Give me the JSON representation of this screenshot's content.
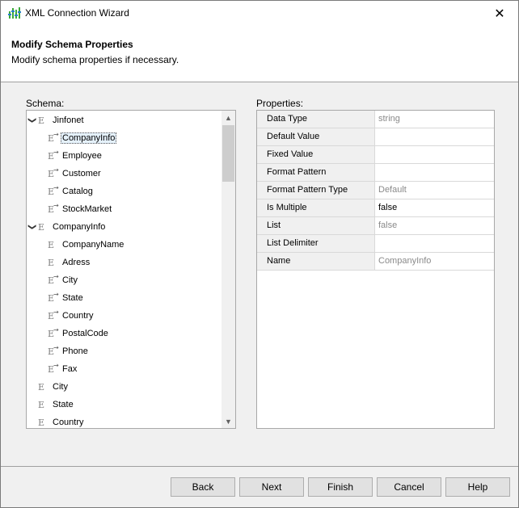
{
  "window": {
    "title": "XML Connection Wizard"
  },
  "header": {
    "title": "Modify Schema Properties",
    "subtitle": "Modify schema properties if necessary."
  },
  "schema": {
    "label": "Schema:",
    "nodes": [
      {
        "label": "Jinfonet",
        "expanded": true,
        "level": 0,
        "icon": "element-icon",
        "ref": false
      },
      {
        "label": "CompanyInfo",
        "level": 1,
        "icon": "element-ref-icon",
        "ref": true,
        "selected": true
      },
      {
        "label": "Employee",
        "level": 1,
        "icon": "element-ref-icon",
        "ref": true
      },
      {
        "label": "Customer",
        "level": 1,
        "icon": "element-ref-icon",
        "ref": true
      },
      {
        "label": "Catalog",
        "level": 1,
        "icon": "element-ref-icon",
        "ref": true
      },
      {
        "label": "StockMarket",
        "level": 1,
        "icon": "element-ref-icon",
        "ref": true
      },
      {
        "label": "CompanyInfo",
        "expanded": true,
        "level": 0,
        "icon": "element-icon",
        "ref": false
      },
      {
        "label": "CompanyName",
        "level": 1,
        "icon": "element-icon",
        "ref": false
      },
      {
        "label": "Adress",
        "level": 1,
        "icon": "element-icon",
        "ref": false
      },
      {
        "label": "City",
        "level": 1,
        "icon": "element-ref-icon",
        "ref": true
      },
      {
        "label": "State",
        "level": 1,
        "icon": "element-ref-icon",
        "ref": true
      },
      {
        "label": "Country",
        "level": 1,
        "icon": "element-ref-icon",
        "ref": true
      },
      {
        "label": "PostalCode",
        "level": 1,
        "icon": "element-ref-icon",
        "ref": true
      },
      {
        "label": "Phone",
        "level": 1,
        "icon": "element-ref-icon",
        "ref": true
      },
      {
        "label": "Fax",
        "level": 1,
        "icon": "element-ref-icon",
        "ref": true
      },
      {
        "label": "City",
        "level": 0,
        "icon": "element-icon",
        "ref": false
      },
      {
        "label": "State",
        "level": 0,
        "icon": "element-icon",
        "ref": false
      },
      {
        "label": "Country",
        "level": 0,
        "icon": "element-icon",
        "ref": false
      }
    ]
  },
  "properties": {
    "label": "Properties:",
    "rows": [
      {
        "name": "Data Type",
        "value": "string",
        "editable": false
      },
      {
        "name": "Default Value",
        "value": "",
        "editable": true
      },
      {
        "name": "Fixed Value",
        "value": "",
        "editable": true
      },
      {
        "name": "Format Pattern",
        "value": "",
        "editable": true
      },
      {
        "name": "Format Pattern Type",
        "value": "Default",
        "editable": false
      },
      {
        "name": "Is Multiple",
        "value": "false",
        "editable": true
      },
      {
        "name": "List",
        "value": "false",
        "editable": false
      },
      {
        "name": "List Delimiter",
        "value": "",
        "editable": true
      },
      {
        "name": "Name",
        "value": "CompanyInfo",
        "editable": false
      }
    ]
  },
  "buttons": {
    "back": "Back",
    "next": "Next",
    "finish": "Finish",
    "cancel": "Cancel",
    "help": "Help"
  },
  "colors": {
    "selection": "#e5f1fb",
    "dim_text": "#8a8a8a",
    "app_icon_green": "#3aa83a"
  }
}
